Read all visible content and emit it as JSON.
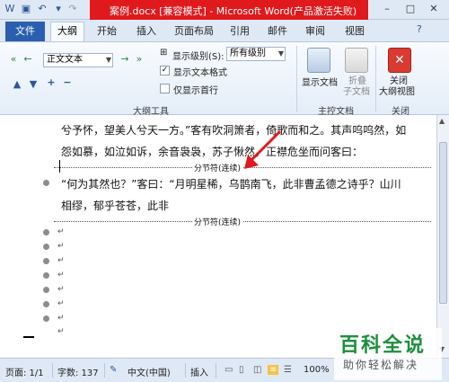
{
  "window": {
    "title": "案例.docx [兼容模式] - Microsoft Word(产品激活失败)",
    "controls": [
      "–",
      "□",
      "✕"
    ]
  },
  "tabs": {
    "file": "文件",
    "active": "大纲",
    "items": [
      "开始",
      "插入",
      "页面布局",
      "引用",
      "邮件",
      "审阅",
      "视图"
    ]
  },
  "ribbon": {
    "outline_tools": {
      "style_combo": "正文文本",
      "show_level_label": "显示级别(S):",
      "show_level_value": "所有级别",
      "show_text_format": "显示文本格式",
      "show_text_format_checked": true,
      "first_line_only": "仅显示首行",
      "first_line_only_checked": false,
      "group_label": "大纲工具"
    },
    "master_doc": {
      "show_doc": "显示文档",
      "collapse_line1": "折叠",
      "collapse_line2": "子文档",
      "group_label": "主控文档"
    },
    "close": {
      "line1": "关闭",
      "line2": "大纲视图",
      "group_label": "关闭"
    }
  },
  "document": {
    "line1": "兮予怀，望美人兮天一方。”客有吹洞箫者，倚歌而和之。其声呜呜然，如",
    "line2": "怨如慕，如泣如诉，余音袅袅，苏子愀然，正襟危坐而问客曰：",
    "section_break_1": "分节符(连续)",
    "line3": "“何为其然也？”客曰：“月明星稀，乌鹊南飞，此非曹孟德之诗乎？山川",
    "line4": "相缪，郁乎苍苍，此非",
    "section_break_2": "分节符(连续)",
    "empty_paragraph_mark": "↵"
  },
  "statusbar": {
    "page": "页面: 1/1",
    "words": "字数: 137",
    "language": "中文(中国)",
    "insert": "插入",
    "zoom": "100%"
  },
  "watermark": {
    "title": "百科全说",
    "subtitle": "助你轻松解决"
  },
  "colors": {
    "title_accent": "#e0191c",
    "file_tab": "#2a5fb0",
    "ribbon_bg": "#e4edf8",
    "watermark_green": "#1d8f3d"
  }
}
